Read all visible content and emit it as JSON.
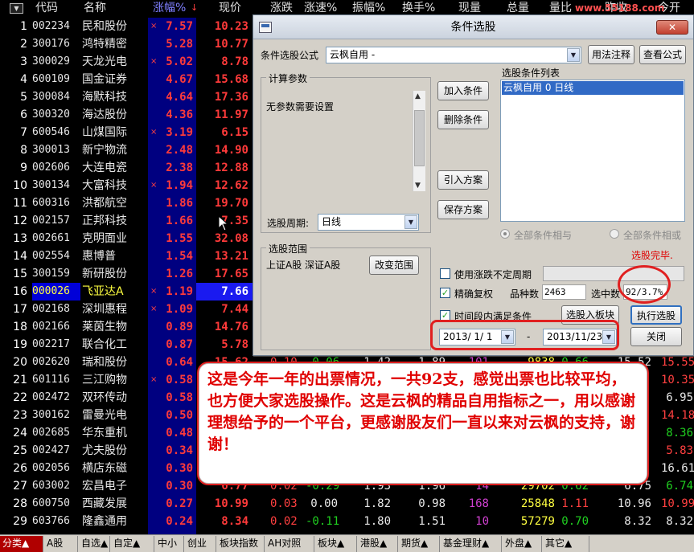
{
  "header": {
    "cols": [
      "代码",
      "名称",
      "涨幅%",
      "现价",
      "涨跌",
      "涨速%",
      "振幅%",
      "换手%",
      "现量",
      "总量",
      "量比",
      "昨收",
      "今开"
    ],
    "sort_arrow": "↓",
    "watermark": "www.55188.com"
  },
  "rows": [
    {
      "idx": "1",
      "code": "002234",
      "name": "民和股份",
      "mark": "×",
      "pct": "7.57",
      "price": "10.23"
    },
    {
      "idx": "2",
      "code": "300176",
      "name": "鸿特精密",
      "mark": "",
      "pct": "5.28",
      "price": "10.77"
    },
    {
      "idx": "3",
      "code": "300029",
      "name": "天龙光电",
      "mark": "×",
      "pct": "5.02",
      "price": "8.78"
    },
    {
      "idx": "4",
      "code": "600109",
      "name": "国金证券",
      "mark": "",
      "pct": "4.67",
      "price": "15.68"
    },
    {
      "idx": "5",
      "code": "300084",
      "name": "海默科技",
      "mark": "",
      "pct": "4.64",
      "price": "17.36"
    },
    {
      "idx": "6",
      "code": "300320",
      "name": "海达股份",
      "mark": "",
      "pct": "4.36",
      "price": "11.97"
    },
    {
      "idx": "7",
      "code": "600546",
      "name": "山煤国际",
      "mark": "×",
      "pct": "3.19",
      "price": "6.15"
    },
    {
      "idx": "8",
      "code": "300013",
      "name": "新宁物流",
      "mark": "",
      "pct": "2.48",
      "price": "14.90"
    },
    {
      "idx": "9",
      "code": "002606",
      "name": "大连电瓷",
      "mark": "",
      "pct": "2.38",
      "price": "12.88"
    },
    {
      "idx": "10",
      "code": "300134",
      "name": "大富科技",
      "mark": "×",
      "pct": "1.94",
      "price": "12.62"
    },
    {
      "idx": "11",
      "code": "600316",
      "name": "洪都航空",
      "mark": "",
      "pct": "1.86",
      "price": "19.70"
    },
    {
      "idx": "12",
      "code": "002157",
      "name": "正邦科技",
      "mark": "",
      "pct": "1.66",
      "price": "7.35"
    },
    {
      "idx": "13",
      "code": "002661",
      "name": "克明面业",
      "mark": "",
      "pct": "1.55",
      "price": "32.08"
    },
    {
      "idx": "14",
      "code": "002554",
      "name": "惠博普",
      "mark": "",
      "pct": "1.54",
      "price": "13.21"
    },
    {
      "idx": "15",
      "code": "300159",
      "name": "新研股份",
      "mark": "",
      "pct": "1.26",
      "price": "17.65"
    },
    {
      "idx": "16",
      "code": "000026",
      "name": "飞亚达A",
      "mark": "×",
      "pct": "1.19",
      "price": "7.66",
      "selected": true
    },
    {
      "idx": "17",
      "code": "002168",
      "name": "深圳惠程",
      "mark": "×",
      "pct": "1.09",
      "price": "7.44"
    },
    {
      "idx": "18",
      "code": "002166",
      "name": "莱茵生物",
      "mark": "",
      "pct": "0.89",
      "price": "14.76"
    },
    {
      "idx": "19",
      "code": "002217",
      "name": "联合化工",
      "mark": "",
      "pct": "0.87",
      "price": "5.78"
    },
    {
      "idx": "20",
      "code": "002620",
      "name": "瑞和股份",
      "mark": "",
      "pct": "0.64",
      "price": "15.62",
      "rest": [
        [
          "0.10",
          "#ff4040"
        ],
        [
          "-0.06",
          "#20d020"
        ],
        [
          "1.42",
          "#e8e8e8"
        ],
        [
          "1.89",
          "#e8e8e8"
        ],
        [
          "101",
          "#d040d0"
        ],
        [
          "9838",
          "#ffff40"
        ],
        [
          "0.66",
          "#20d020"
        ],
        [
          "15.52",
          "#e8e8e8"
        ],
        [
          "15.55",
          "#ff4040"
        ]
      ]
    },
    {
      "idx": "21",
      "code": "601116",
      "name": "三江购物",
      "mark": "×",
      "pct": "0.58",
      "price": "",
      "rest": [
        [
          "",
          "#fff"
        ],
        [
          "",
          "#fff"
        ],
        [
          "",
          "#fff"
        ],
        [
          "",
          "#fff"
        ],
        [
          "",
          "#fff"
        ],
        [
          "",
          "#fff"
        ],
        [
          "",
          "#fff"
        ],
        [
          "",
          "#fff"
        ],
        [
          "10.35",
          "#ff4040"
        ]
      ]
    },
    {
      "idx": "22",
      "code": "002472",
      "name": "双环传动",
      "mark": "",
      "pct": "0.58",
      "price": "",
      "rest": [
        [
          "",
          "#fff"
        ],
        [
          "",
          "#fff"
        ],
        [
          "",
          "#fff"
        ],
        [
          "",
          "#fff"
        ],
        [
          "",
          "#fff"
        ],
        [
          "",
          "#fff"
        ],
        [
          "",
          "#fff"
        ],
        [
          "",
          "#fff"
        ],
        [
          "6.95",
          "#e8e8e8"
        ]
      ]
    },
    {
      "idx": "23",
      "code": "300162",
      "name": "雷曼光电",
      "mark": "",
      "pct": "0.50",
      "price": "",
      "rest": [
        [
          "",
          "#fff"
        ],
        [
          "",
          "#fff"
        ],
        [
          "",
          "#fff"
        ],
        [
          "",
          "#fff"
        ],
        [
          "",
          "#fff"
        ],
        [
          "",
          "#fff"
        ],
        [
          "",
          "#fff"
        ],
        [
          "",
          "#fff"
        ],
        [
          "14.18",
          "#ff4040"
        ]
      ]
    },
    {
      "idx": "24",
      "code": "002685",
      "name": "华东重机",
      "mark": "",
      "pct": "0.48",
      "price": "",
      "rest": [
        [
          "",
          "#fff"
        ],
        [
          "",
          "#fff"
        ],
        [
          "",
          "#fff"
        ],
        [
          "",
          "#fff"
        ],
        [
          "",
          "#fff"
        ],
        [
          "",
          "#fff"
        ],
        [
          "",
          "#fff"
        ],
        [
          "",
          "#fff"
        ],
        [
          "8.36",
          "#20d020"
        ]
      ]
    },
    {
      "idx": "25",
      "code": "002427",
      "name": "尤夫股份",
      "mark": "",
      "pct": "0.34",
      "price": "",
      "rest": [
        [
          "",
          "#fff"
        ],
        [
          "",
          "#fff"
        ],
        [
          "",
          "#fff"
        ],
        [
          "",
          "#fff"
        ],
        [
          "",
          "#fff"
        ],
        [
          "",
          "#fff"
        ],
        [
          "",
          "#fff"
        ],
        [
          "",
          "#fff"
        ],
        [
          "5.83",
          "#ff4040"
        ]
      ]
    },
    {
      "idx": "26",
      "code": "002056",
      "name": "横店东磁",
      "mark": "",
      "pct": "0.30",
      "price": "",
      "rest": [
        [
          "",
          "#fff"
        ],
        [
          "",
          "#fff"
        ],
        [
          "",
          "#fff"
        ],
        [
          "",
          "#fff"
        ],
        [
          "",
          "#fff"
        ],
        [
          "",
          "#fff"
        ],
        [
          "",
          "#fff"
        ],
        [
          "",
          "#fff"
        ],
        [
          "16.61",
          "#e8e8e8"
        ]
      ]
    },
    {
      "idx": "27",
      "code": "603002",
      "name": "宏昌电子",
      "mark": "",
      "pct": "0.30",
      "price": "6.77",
      "rest": [
        [
          "0.02",
          "#ff4040"
        ],
        [
          "-0.29",
          "#20d020"
        ],
        [
          "1.93",
          "#e8e8e8"
        ],
        [
          "1.96",
          "#e8e8e8"
        ],
        [
          "14",
          "#d040d0"
        ],
        [
          "29702",
          "#ffff40"
        ],
        [
          "0.62",
          "#20d020"
        ],
        [
          "6.75",
          "#e8e8e8"
        ],
        [
          "6.74",
          "#20d020"
        ]
      ]
    },
    {
      "idx": "28",
      "code": "600750",
      "name": "西藏发展",
      "mark": "",
      "pct": "0.27",
      "price": "10.99",
      "rest": [
        [
          "0.03",
          "#ff4040"
        ],
        [
          "0.00",
          "#e8e8e8"
        ],
        [
          "1.82",
          "#e8e8e8"
        ],
        [
          "0.98",
          "#e8e8e8"
        ],
        [
          "168",
          "#d040d0"
        ],
        [
          "25848",
          "#ffff40"
        ],
        [
          "1.11",
          "#ff4040"
        ],
        [
          "10.96",
          "#e8e8e8"
        ],
        [
          "10.99",
          "#ff4040"
        ]
      ]
    },
    {
      "idx": "29",
      "code": "603766",
      "name": "隆鑫通用",
      "mark": "",
      "pct": "0.24",
      "price": "8.34",
      "rest": [
        [
          "0.02",
          "#ff4040"
        ],
        [
          "-0.11",
          "#20d020"
        ],
        [
          "1.80",
          "#e8e8e8"
        ],
        [
          "1.51",
          "#e8e8e8"
        ],
        [
          "10",
          "#d040d0"
        ],
        [
          "57279",
          "#ffff40"
        ],
        [
          "0.70",
          "#20d020"
        ],
        [
          "8.32",
          "#e8e8e8"
        ],
        [
          "8.32",
          "#e8e8e8"
        ]
      ]
    }
  ],
  "tabs": [
    "分类▲",
    "A股",
    "自选▲",
    "自定▲",
    "中小",
    "创业",
    "板块指数",
    "AH对照",
    "板块▲",
    "港股▲",
    "期货▲",
    "基金理财▲",
    "外盘▲",
    "其它▲"
  ],
  "dialog": {
    "title": "条件选股",
    "close": "✕",
    "formula_label": "条件选股公式",
    "formula_value": "云枫自用 -",
    "usage_btn": "用法注释",
    "view_formula_btn": "查看公式",
    "calc_params_title": "计算参数",
    "no_params": "无参数需要设置",
    "period_label": "选股周期:",
    "period_value": "日线",
    "scope_title": "选股范围",
    "scope_value": "上证A股 深证A股",
    "change_scope_btn": "改变范围",
    "add_cond_btn": "加入条件",
    "del_cond_btn": "删除条件",
    "import_btn": "引入方案",
    "save_btn": "保存方案",
    "cond_list_title": "选股条件列表",
    "cond_item": "云枫自用  0  日线",
    "radio_and": "全部条件相与",
    "radio_or": "全部条件相或",
    "status": "选股完毕.",
    "chk_uncertain": "使用涨跌不定周期",
    "chk_fq": "精确复权",
    "count_label": "品种数",
    "count_value": "2463",
    "selected_label": "选中数",
    "selected_value": "92/3.7%",
    "chk_period": "时间段内满足条件",
    "to_sector_btn": "选股入板块",
    "exec_btn": "执行选股",
    "date_from": "2013/ 1/ 1",
    "dash": "-",
    "date_to": "2013/11/23",
    "close_btn": "关闭"
  },
  "note": "这是今年一年的出票情况，一共92支，感觉出票也比较平均，也方便大家选股操作。这是云枫的精品自用指标之一，用以感谢理想给予的一个平台，更感谢股友们一直以来对云枫的支持，谢谢！",
  "colors": {
    "up": "#ff3a3a",
    "down": "#20d020",
    "volume": "#ffff40",
    "annotation": "#e00000",
    "selected_row": "#1a1af0"
  }
}
